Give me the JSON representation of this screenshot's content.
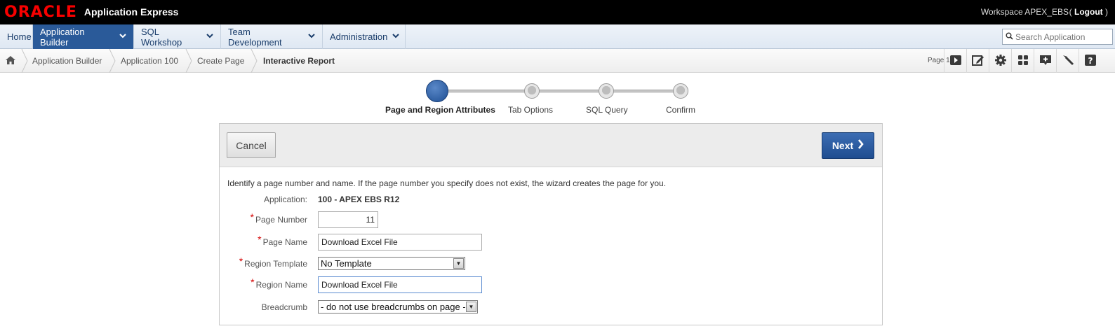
{
  "header": {
    "logo_oracle": "ORACLE",
    "logo_app": "Application Express",
    "workspace": "Workspace APEX_EBS",
    "logout": "Logout"
  },
  "menu": {
    "items": [
      {
        "label": "Home"
      },
      {
        "label": "Application Builder"
      },
      {
        "label": "SQL Workshop"
      },
      {
        "label": "Team Development"
      },
      {
        "label": "Administration"
      }
    ],
    "search_placeholder": "Search Application"
  },
  "breadcrumb": {
    "items": [
      "Application Builder",
      "Application 100",
      "Create Page"
    ],
    "current": "Interactive Report",
    "page_label": "Page 1"
  },
  "wizard": {
    "steps": [
      "Page and Region Attributes",
      "Tab Options",
      "SQL Query",
      "Confirm"
    ],
    "active_step": 0
  },
  "buttons": {
    "cancel": "Cancel",
    "next": "Next"
  },
  "form": {
    "instruction": "Identify a page number and name. If the page number you specify does not exist, the wizard creates the page for you.",
    "application_label": "Application:",
    "application_value": "100 - APEX EBS R12",
    "page_number_label": "Page Number",
    "page_number_value": "11",
    "page_name_label": "Page Name",
    "page_name_value": "Download Excel File",
    "region_template_label": "Region Template",
    "region_template_value": "No Template",
    "region_name_label": "Region Name",
    "region_name_value": "Download Excel File",
    "breadcrumb_label": "Breadcrumb",
    "breadcrumb_value": "- do not use breadcrumbs on page -",
    "required_mark": "*"
  },
  "colors": {
    "header_bg": "#000000",
    "oracle_red": "#f80000",
    "active_menu": "#2a5a99",
    "next_button": "#2a5a9e",
    "required": "#d40000"
  },
  "icons": [
    "home-icon",
    "chevron-down-icon",
    "search-icon",
    "run-page-icon",
    "edit-icon",
    "gear-icon",
    "shared-components-icon",
    "create-icon",
    "developer-tools-icon",
    "help-icon",
    "chevron-right-icon"
  ]
}
